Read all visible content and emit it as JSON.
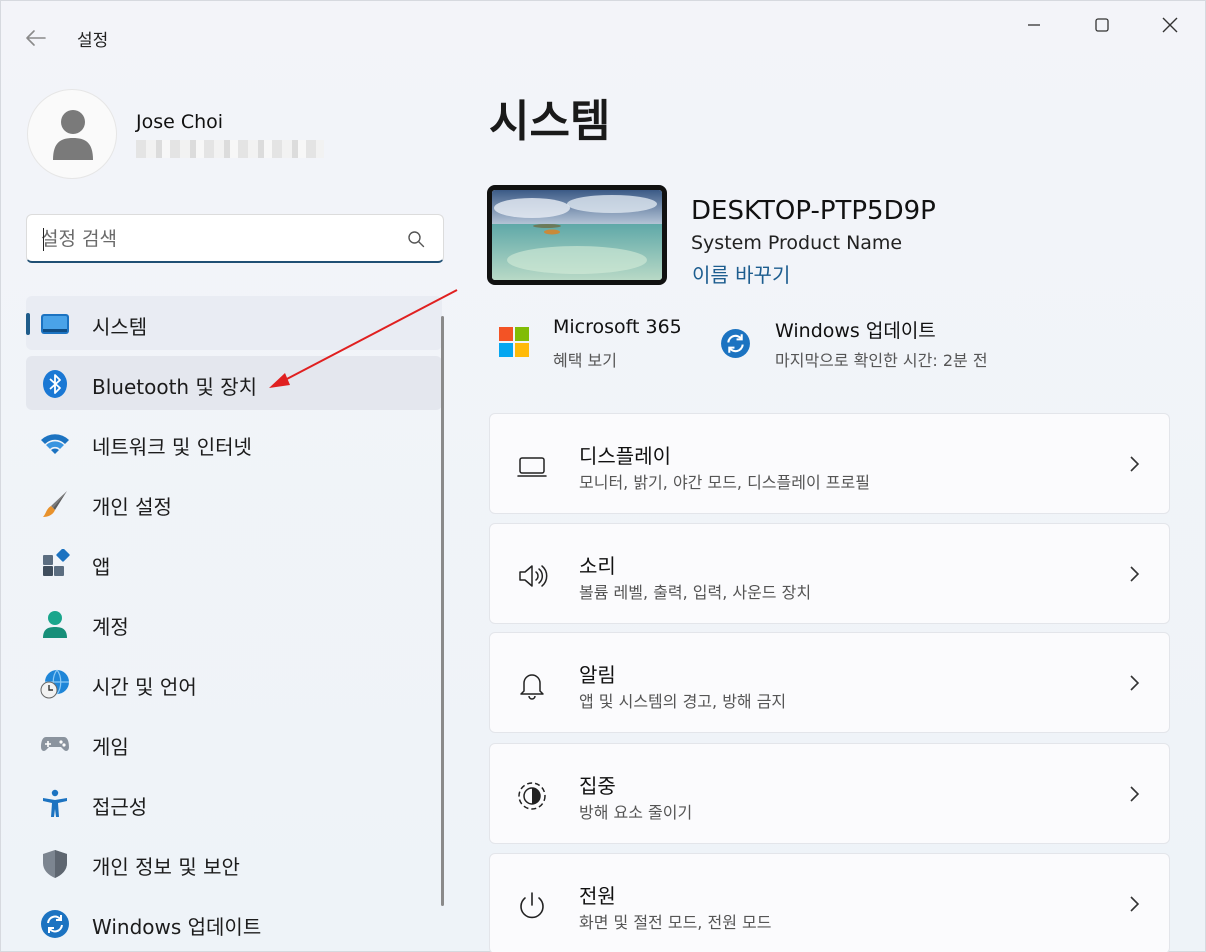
{
  "app": {
    "title": "설정"
  },
  "profile": {
    "name": "Jose Choi"
  },
  "search": {
    "placeholder": "설정 검색"
  },
  "nav": {
    "items": [
      {
        "label": "시스템"
      },
      {
        "label": "Bluetooth 및 장치"
      },
      {
        "label": "네트워크 및 인터넷"
      },
      {
        "label": "개인 설정"
      },
      {
        "label": "앱"
      },
      {
        "label": "계정"
      },
      {
        "label": "시간 및 언어"
      },
      {
        "label": "게임"
      },
      {
        "label": "접근성"
      },
      {
        "label": "개인 정보 및 보안"
      },
      {
        "label": "Windows 업데이트"
      }
    ]
  },
  "main": {
    "title": "시스템",
    "device": {
      "name": "DESKTOP-PTP5D9P",
      "model": "System Product Name",
      "rename_label": "이름 바꾸기"
    },
    "quick": [
      {
        "title": "Microsoft 365",
        "subtitle": "혜택 보기"
      },
      {
        "title": "Windows 업데이트",
        "subtitle": "마지막으로 확인한 시간: 2분 전"
      }
    ],
    "cards": [
      {
        "title": "디스플레이",
        "subtitle": "모니터, 밝기, 야간 모드, 디스플레이 프로필",
        "icon": "display-icon"
      },
      {
        "title": "소리",
        "subtitle": "볼륨 레벨, 출력, 입력, 사운드 장치",
        "icon": "speaker-icon"
      },
      {
        "title": "알림",
        "subtitle": "앱 및 시스템의 경고, 방해 금지",
        "icon": "bell-icon"
      },
      {
        "title": "집중",
        "subtitle": "방해 요소 줄이기",
        "icon": "focus-icon"
      },
      {
        "title": "전원",
        "subtitle": "화면 및 절전 모드, 전원 모드",
        "icon": "power-icon"
      }
    ]
  },
  "colors": {
    "accent": "#1f5c8a",
    "link": "#1d5d8f",
    "annotation": "#e02020"
  }
}
